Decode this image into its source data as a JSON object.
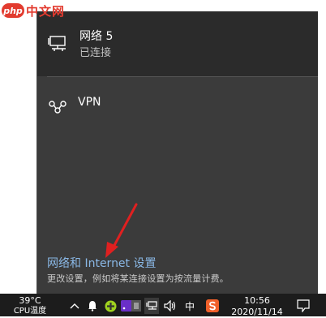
{
  "watermark": {
    "logo": "php",
    "site": "中文网"
  },
  "network": {
    "name": "网络 5",
    "status": "已连接",
    "icon": "ethernet-icon"
  },
  "vpn": {
    "label": "VPN",
    "icon": "vpn-icon"
  },
  "settings": {
    "link": "网络和 Internet 设置",
    "description": "更改设置，例如将某连接设置为按流量计费。"
  },
  "taskbar": {
    "temp": "39°C",
    "temp_label": "CPU温度",
    "ime": "中",
    "time": "10:56",
    "date": "2020/11/14"
  },
  "colors": {
    "flyout_bg": "#3b3b3b",
    "selected_bg": "#2b2b2b",
    "link": "#8ab8e6",
    "taskbar_bg": "#1c1c1c",
    "arrow": "#e02020"
  }
}
